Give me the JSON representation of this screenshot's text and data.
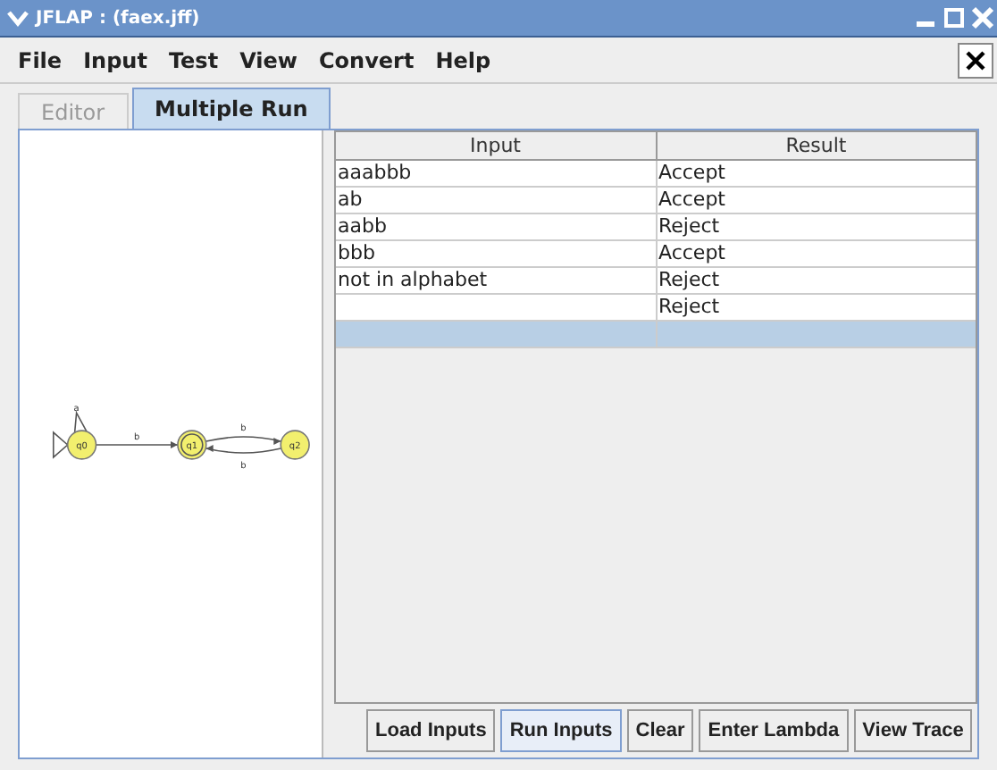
{
  "window": {
    "title": "JFLAP : (faex.jff)"
  },
  "menu": [
    "File",
    "Input",
    "Test",
    "View",
    "Convert",
    "Help"
  ],
  "tabs": [
    {
      "label": "Editor",
      "selected": false
    },
    {
      "label": "Multiple Run",
      "selected": true
    }
  ],
  "automaton": {
    "states": [
      {
        "name": "q0",
        "initial": true,
        "final": false
      },
      {
        "name": "q1",
        "initial": false,
        "final": true
      },
      {
        "name": "q2",
        "initial": false,
        "final": false
      }
    ],
    "transitions": [
      {
        "kind": "loop",
        "label": "a"
      },
      {
        "kind": "straight",
        "label": "b"
      },
      {
        "kind": "over",
        "label": "b"
      },
      {
        "kind": "under",
        "label": "b"
      }
    ]
  },
  "table": {
    "columns": [
      "Input",
      "Result"
    ],
    "rows": [
      {
        "input": "aaabbb",
        "result": "Accept",
        "selected": false
      },
      {
        "input": "ab",
        "result": "Accept",
        "selected": false
      },
      {
        "input": "aabb",
        "result": "Reject",
        "selected": false
      },
      {
        "input": "bbb",
        "result": "Accept",
        "selected": false
      },
      {
        "input": "not in alphabet",
        "result": "Reject",
        "selected": false
      },
      {
        "result": "Reject",
        "selected": false
      },
      {
        "selected": true
      }
    ]
  },
  "buttons": [
    {
      "label": "Load Inputs",
      "focused": false
    },
    {
      "label": "Run Inputs",
      "focused": true
    },
    {
      "label": "Clear",
      "focused": false
    },
    {
      "label": "Enter Lambda",
      "focused": false
    },
    {
      "label": "View Trace",
      "focused": false
    }
  ]
}
